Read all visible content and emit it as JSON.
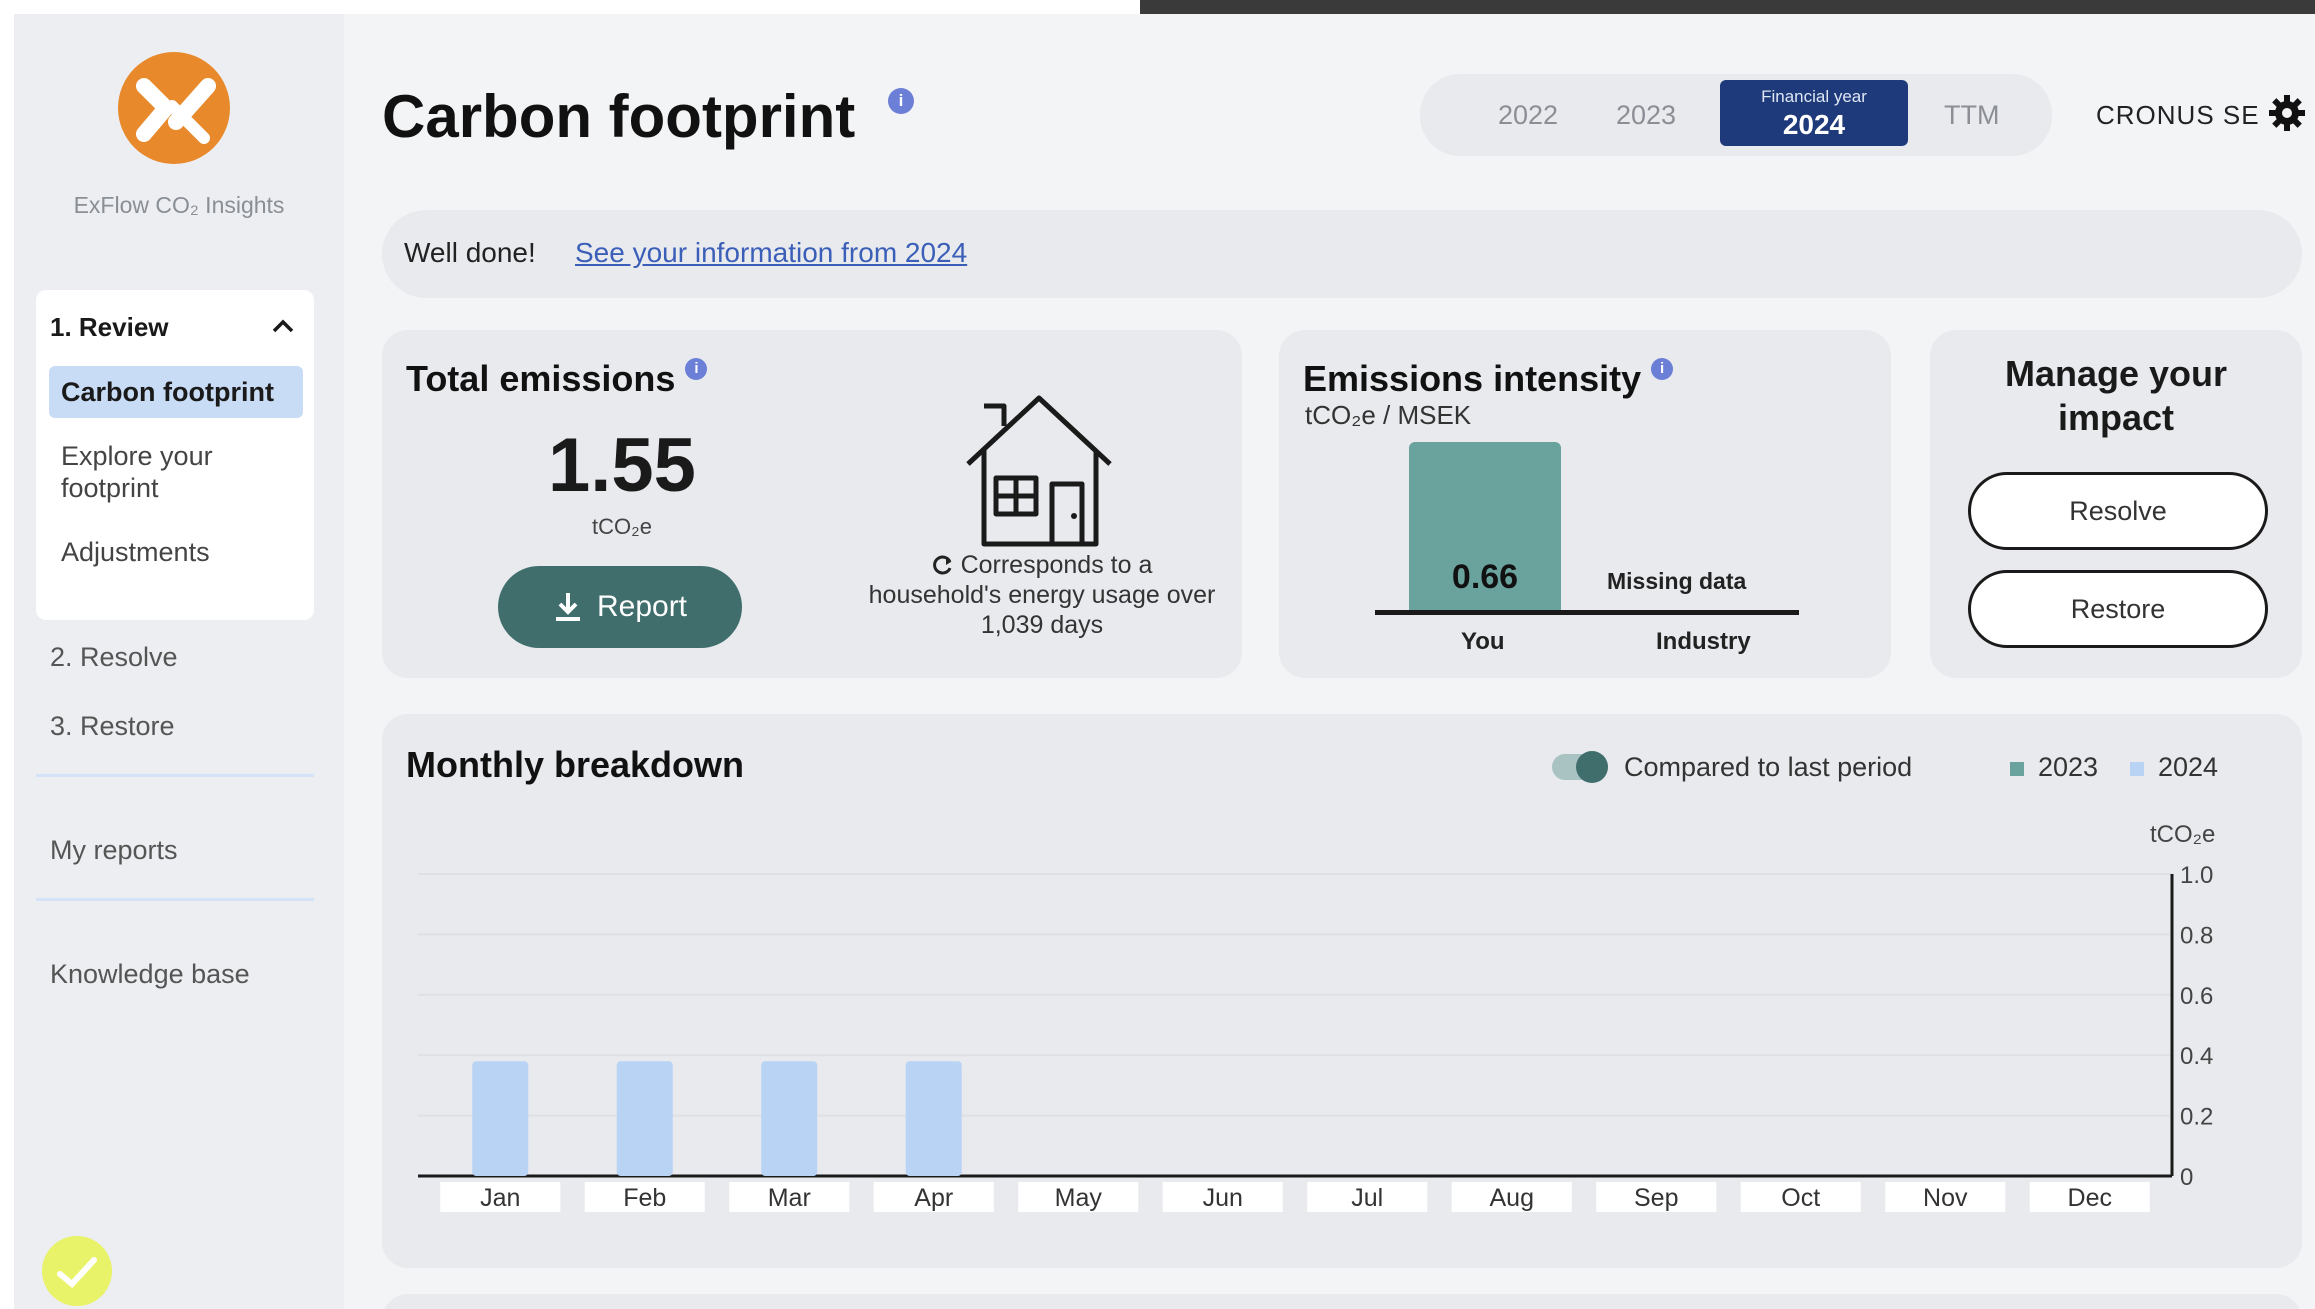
{
  "app": {
    "logo_caption": "ExFlow CO₂ Insights"
  },
  "sidebar": {
    "step1_title": "1. Review",
    "items": [
      "Carbon footprint",
      "Explore your footprint",
      "Adjustments"
    ],
    "step2": "2. Resolve",
    "step3": "3. Restore",
    "my_reports": "My reports",
    "knowledge_base": "Knowledge base"
  },
  "header": {
    "title": "Carbon footprint",
    "years": [
      "2022",
      "2023"
    ],
    "active_sub": "Financial year",
    "active_year": "2024",
    "ttm": "TTM",
    "company": "CRONUS SE"
  },
  "banner": {
    "text": "Well done!",
    "link": "See your information from 2024"
  },
  "total_emissions": {
    "title": "Total emissions",
    "value": "1.55",
    "unit": "tCO₂e",
    "report_button": "Report",
    "household_text": "Corresponds to a household's energy usage over 1,039 days"
  },
  "intensity": {
    "title": "Emissions intensity",
    "unit": "tCO₂e / MSEK",
    "you_value": "0.66",
    "you_label": "You",
    "industry_label": "Industry",
    "missing": "Missing data"
  },
  "manage": {
    "title_line1": "Manage your",
    "title_line2": "impact",
    "resolve": "Resolve",
    "restore": "Restore"
  },
  "monthly": {
    "title": "Monthly breakdown",
    "toggle_label": "Compared to last period",
    "legend_2023": "2023",
    "legend_2024": "2024"
  },
  "colors": {
    "accent_dark": "#1e3a7a",
    "teal": "#3f6e6c",
    "bar_2024": "#b9d3f5",
    "bar_2023": "#6aa39e"
  },
  "chart_data": {
    "type": "bar",
    "categories": [
      "Jan",
      "Feb",
      "Mar",
      "Apr",
      "May",
      "Jun",
      "Jul",
      "Aug",
      "Sep",
      "Oct",
      "Nov",
      "Dec"
    ],
    "series": [
      {
        "name": "2024",
        "values": [
          0.38,
          0.38,
          0.38,
          0.38,
          0,
          0,
          0,
          0,
          0,
          0,
          0,
          0
        ]
      }
    ],
    "ylabel": "tCO₂e",
    "yticks": [
      "0",
      "0.2",
      "0.4",
      "0.6",
      "0.8",
      "1.0"
    ],
    "ylim": [
      0,
      1.0
    ],
    "grid": true
  }
}
